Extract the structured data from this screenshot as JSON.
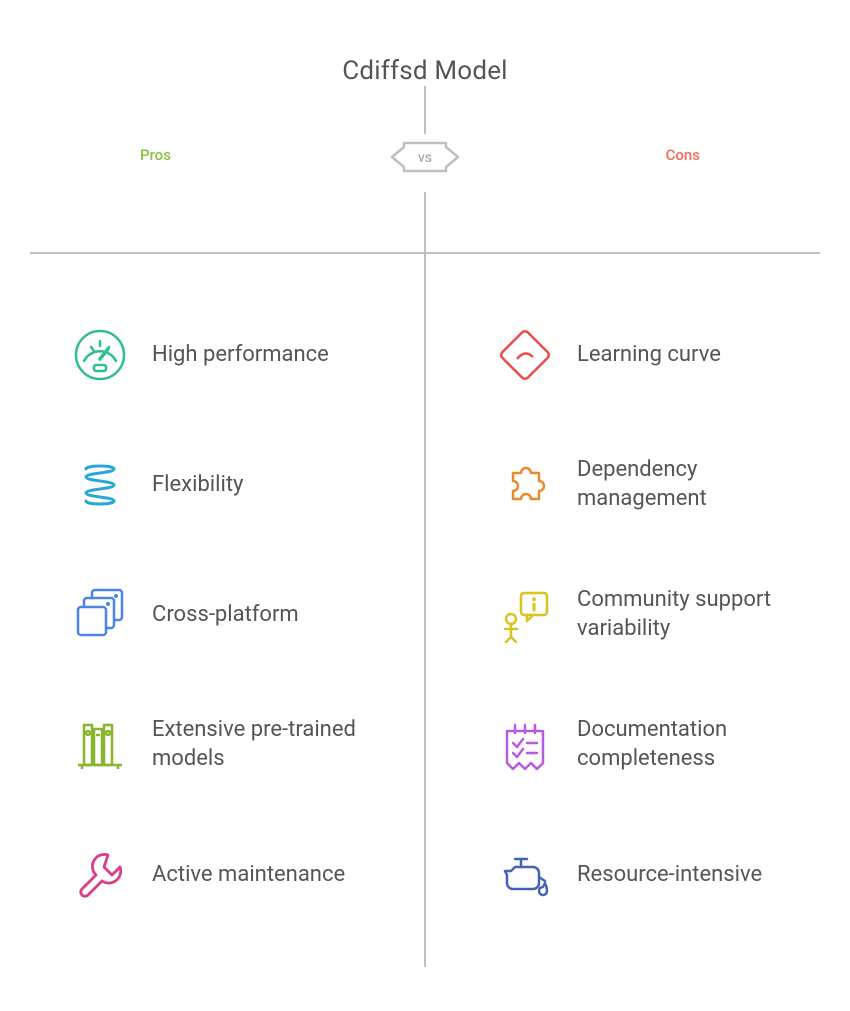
{
  "title": "Cdiffsd Model",
  "vs": "vs",
  "labels": {
    "pros": "Pros",
    "cons": "Cons"
  },
  "pros": [
    {
      "text": "High performance",
      "color": "#2fbf8a",
      "icon": "gauge"
    },
    {
      "text": "Flexibility",
      "color": "#2aa6d7",
      "icon": "spring"
    },
    {
      "text": "Cross-platform",
      "color": "#4b84e5",
      "icon": "windows"
    },
    {
      "text": "Extensive pre-trained models",
      "color": "#88b52c",
      "icon": "books"
    },
    {
      "text": "Active maintenance",
      "color": "#d93e8a",
      "icon": "wrench"
    }
  ],
  "cons": [
    {
      "text": "Learning curve",
      "color": "#ec4b4b",
      "icon": "warning"
    },
    {
      "text": "Dependency management",
      "color": "#e58c2b",
      "icon": "puzzle"
    },
    {
      "text": "Community support variability",
      "color": "#d9c41a",
      "icon": "info-person"
    },
    {
      "text": "Documentation completeness",
      "color": "#b85be0",
      "icon": "checklist"
    },
    {
      "text": "Resource-intensive",
      "color": "#4563b5",
      "icon": "oil"
    }
  ]
}
